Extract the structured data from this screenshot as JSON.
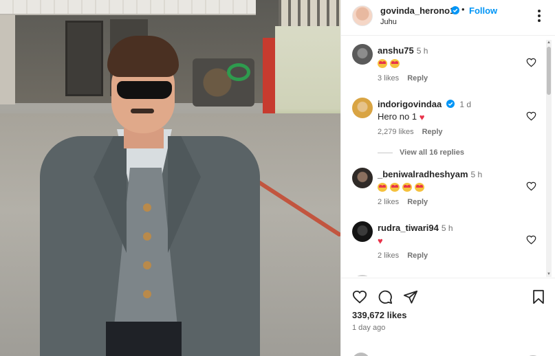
{
  "post": {
    "username": "govinda_herono1",
    "location": "Juhu",
    "follow_label": "Follow",
    "separator": "•"
  },
  "comments": [
    {
      "username": "anshu75",
      "time": "5 h",
      "text": "",
      "emoji": [
        "heart-eyes",
        "heart-eyes"
      ],
      "likes": "3 likes",
      "reply": "Reply",
      "verified": false
    },
    {
      "username": "indorigovindaa",
      "time": "1 d",
      "text": "Hero no 1",
      "emoji": [
        "pink-heart"
      ],
      "likes": "2,279 likes",
      "reply": "Reply",
      "verified": true
    },
    {
      "username": "_beniwalradheshyam",
      "time": "5 h",
      "text": "",
      "emoji": [
        "heart-eyes",
        "heart-eyes",
        "heart-eyes",
        "heart-eyes"
      ],
      "likes": "2 likes",
      "reply": "Reply",
      "verified": false
    },
    {
      "username": "rudra_tiwari94",
      "time": "5 h",
      "text": "",
      "emoji": [
        "pink-heart"
      ],
      "likes": "2 likes",
      "reply": "Reply",
      "verified": false
    }
  ],
  "view_replies": "View all 16 replies",
  "footer": {
    "likes": "339,672 likes",
    "date": "1 day ago"
  },
  "icons": {
    "like": "heart-icon",
    "comment": "comment-icon",
    "share": "share-icon",
    "save": "bookmark-icon",
    "more": "more-options-icon",
    "verified": "verified-badge-icon"
  },
  "colors": {
    "accent": "#0095f6",
    "verified": "#0095f6",
    "heart": "#e8334a"
  }
}
